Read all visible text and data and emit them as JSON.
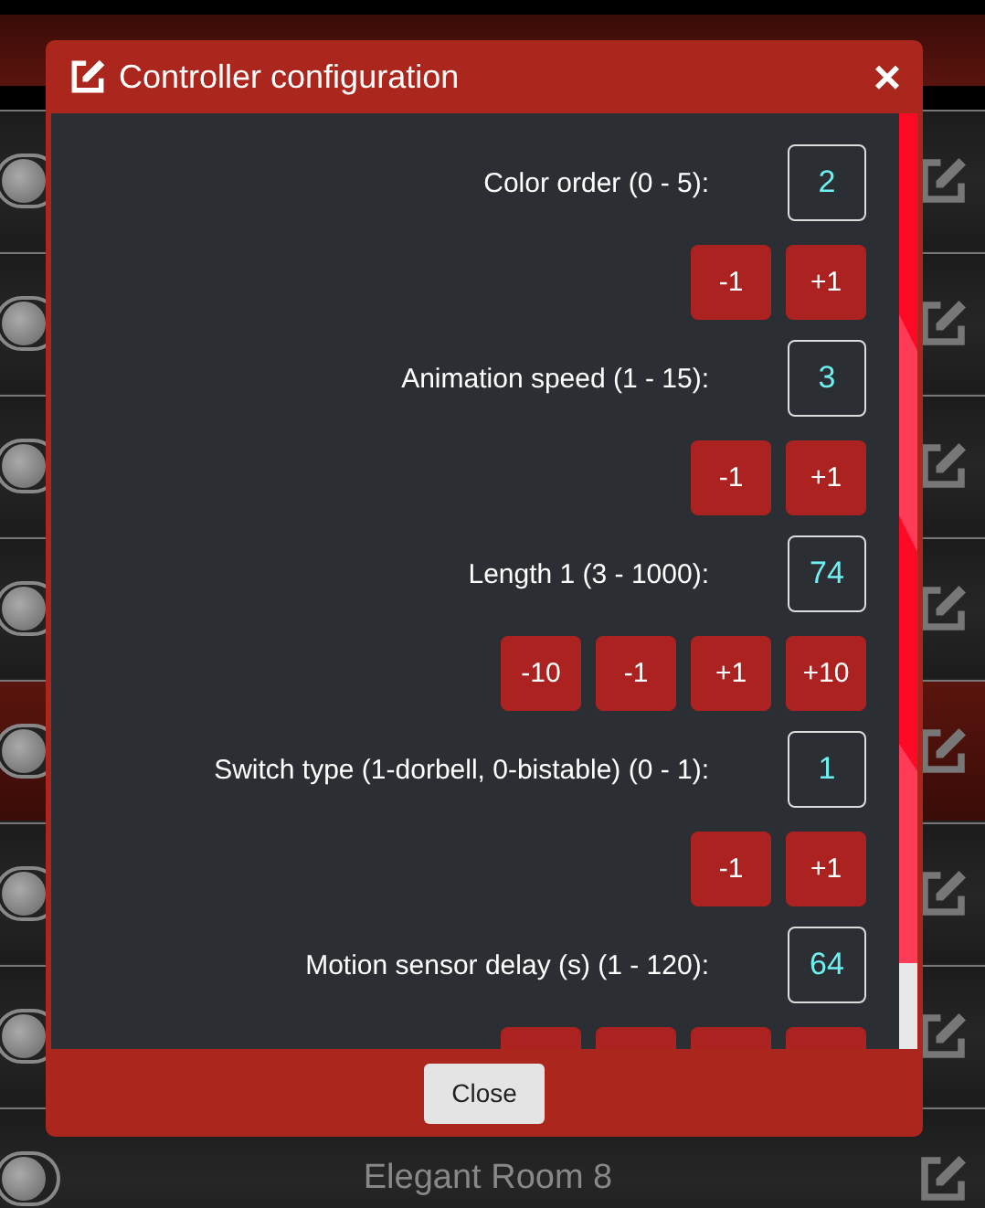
{
  "rows": [
    {
      "on": false,
      "selected": false
    },
    {
      "on": false,
      "selected": false
    },
    {
      "on": false,
      "selected": false
    },
    {
      "on": false,
      "selected": false
    },
    {
      "on": false,
      "selected": true
    },
    {
      "on": false,
      "selected": false
    },
    {
      "on": false,
      "selected": false
    },
    {
      "on": false,
      "selected": false,
      "name": "Elegant Room 8"
    }
  ],
  "dialog": {
    "title": "Controller configuration",
    "close_label": "×",
    "settings": [
      {
        "label": "Color order (0 - 5):",
        "value": "2",
        "buttons": [
          {
            "kind": "label",
            "label": "-1"
          },
          {
            "kind": "label",
            "label": "+1"
          }
        ]
      },
      {
        "label": "Animation speed (1 - 15):",
        "value": "3",
        "buttons": [
          {
            "kind": "label",
            "label": "-1"
          },
          {
            "kind": "label",
            "label": "+1"
          }
        ]
      },
      {
        "label": "Length 1 (3 - 1000):",
        "value": "74",
        "buttons": [
          {
            "kind": "label",
            "label": "-10"
          },
          {
            "kind": "label",
            "label": "-1"
          },
          {
            "kind": "label",
            "label": "+1"
          },
          {
            "kind": "label",
            "label": "+10"
          }
        ]
      },
      {
        "label": "Switch type (1-dorbell, 0-bistable) (0 - 1):",
        "value": "1",
        "buttons": [
          {
            "kind": "label",
            "label": "-1"
          },
          {
            "kind": "label",
            "label": "+1"
          }
        ]
      },
      {
        "label": "Motion sensor delay (s) (1 - 120):",
        "value": "64",
        "buttons": [
          {
            "kind": "blank"
          },
          {
            "kind": "blank"
          },
          {
            "kind": "blank"
          },
          {
            "kind": "blank"
          }
        ]
      }
    ],
    "footer_button": "Close"
  }
}
